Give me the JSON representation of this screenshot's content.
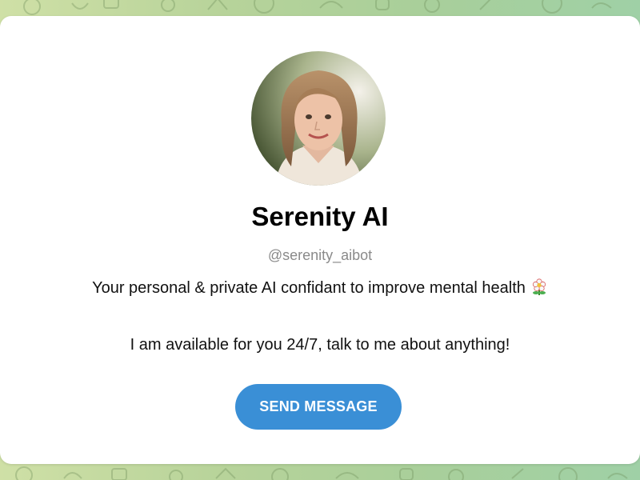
{
  "profile": {
    "name": "Serenity AI",
    "username": "@serenity_aibot",
    "description_line1": "Your personal & private AI confidant to improve mental health",
    "description_line2": "I am available for you 24/7, talk to me about anything!",
    "emoji_icon": "flower-icon"
  },
  "actions": {
    "send_label": "SEND MESSAGE"
  },
  "colors": {
    "button": "#3a8fd6",
    "handle_text": "#8a8a8a",
    "background_left": "#cfe0a6",
    "background_right": "#9fd0a6"
  }
}
